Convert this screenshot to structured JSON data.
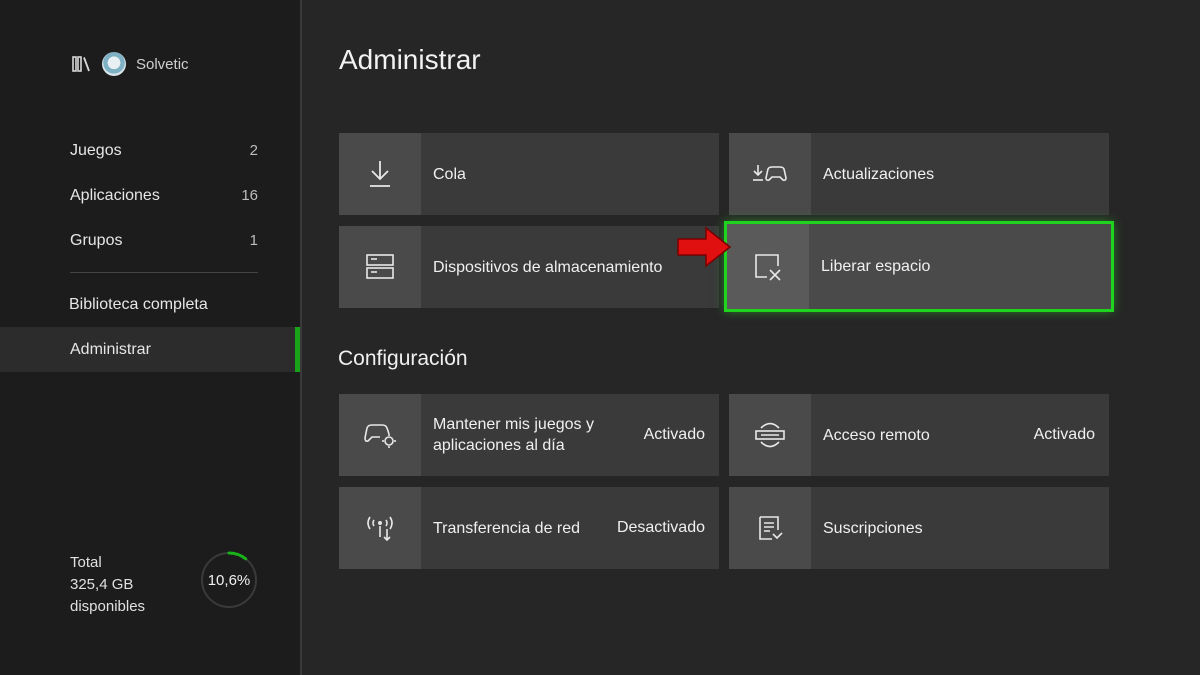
{
  "profile": {
    "name": "Solvetic",
    "library_icon": "library-icon",
    "avatar_icon": "avatar-icon"
  },
  "sidebar": {
    "items": [
      {
        "label": "Juegos",
        "count": "2"
      },
      {
        "label": "Aplicaciones",
        "count": "16"
      },
      {
        "label": "Grupos",
        "count": "1"
      }
    ],
    "library_label": "Biblioteca completa",
    "manage_label": "Administrar"
  },
  "storage": {
    "line1": "Total",
    "line2": "325,4 GB",
    "line3": "disponibles",
    "percent": "10,6%",
    "fill_fraction": 0.106
  },
  "main": {
    "title": "Administrar",
    "tiles": [
      {
        "label": "Cola",
        "icon": "download-icon"
      },
      {
        "label": "Actualizaciones",
        "icon": "update-controller-icon"
      },
      {
        "label": "Dispositivos de almacenamiento",
        "icon": "storage-device-icon"
      },
      {
        "label": "Liberar espacio",
        "icon": "free-space-icon"
      }
    ],
    "config_title": "Configuración",
    "config_tiles": [
      {
        "label": "Mantener mis juegos y aplicaciones al día",
        "value": "Activado",
        "icon": "controller-gear-icon"
      },
      {
        "label": "Acceso remoto",
        "value": "Activado",
        "icon": "remote-access-icon"
      },
      {
        "label": "Transferencia de red",
        "value": "Desactivado",
        "icon": "network-transfer-icon"
      },
      {
        "label": "Suscripciones",
        "value": "",
        "icon": "subscriptions-icon"
      }
    ]
  },
  "colors": {
    "accent_green": "#1fd31f",
    "arrow_red": "#e01010",
    "background": "#262626"
  }
}
